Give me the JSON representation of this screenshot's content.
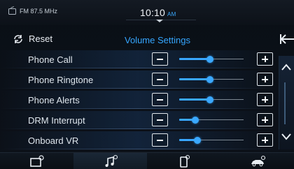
{
  "status": {
    "radio_source": "FM 87.5 MHz",
    "time": "10:10",
    "ampm": "AM"
  },
  "header": {
    "reset_label": "Reset",
    "title": "Volume Settings"
  },
  "volume_items": [
    {
      "label": "Phone Call",
      "level": 0.48
    },
    {
      "label": "Phone Ringtone",
      "level": 0.48
    },
    {
      "label": "Phone Alerts",
      "level": 0.48
    },
    {
      "label": "DRM Interrupt",
      "level": 0.25
    },
    {
      "label": "Onboard VR",
      "level": 0.28
    }
  ],
  "bottom_nav": [
    {
      "icon": "display-settings-icon"
    },
    {
      "icon": "music-settings-icon",
      "active": true
    },
    {
      "icon": "phone-settings-icon"
    },
    {
      "icon": "vehicle-settings-icon"
    }
  ],
  "colors": {
    "accent": "#35a6ff",
    "background": "#0a0f16",
    "text": "#e6ecf2"
  }
}
